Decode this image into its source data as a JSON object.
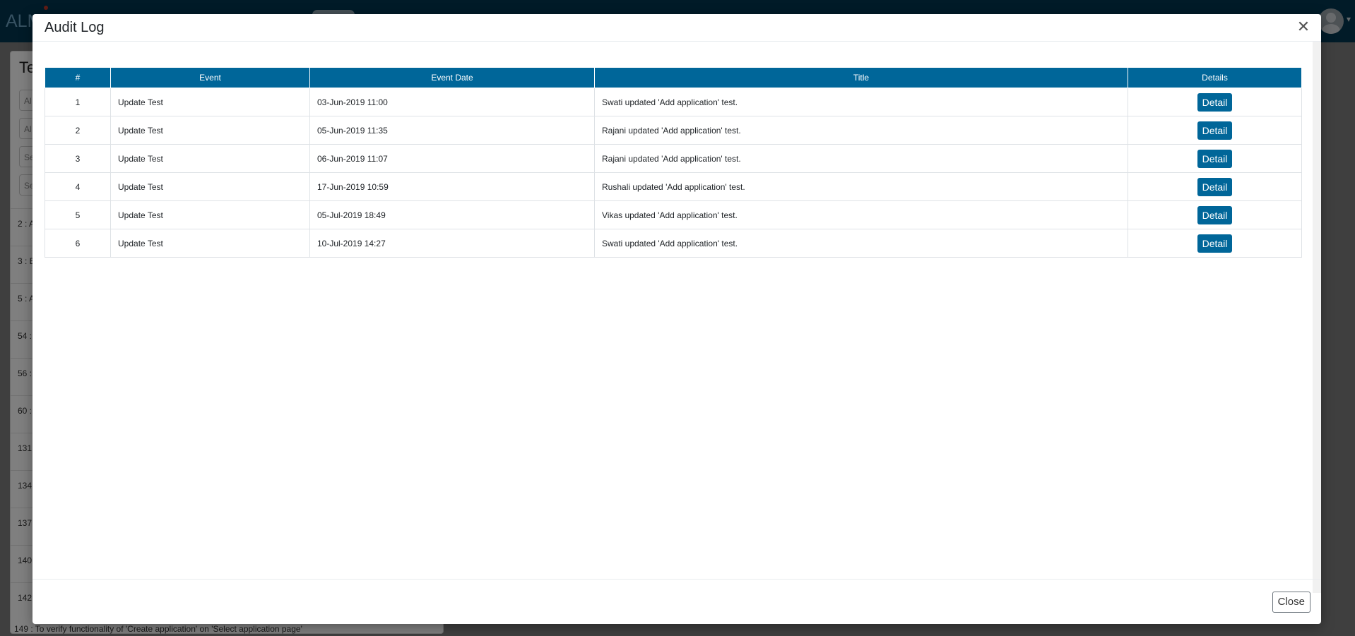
{
  "app": {
    "brand": "ALM"
  },
  "background": {
    "heading": "Te",
    "inputs": [
      "Al",
      "Al",
      "Se",
      "Se"
    ],
    "rows": [
      "2 : A",
      "3 : E",
      "5 : A",
      "54 :",
      "56 :",
      "60 :",
      "131",
      "134",
      "137",
      "140",
      "142"
    ],
    "bottom_text": "149 : To verify functionality of 'Create application' on 'Select application page'"
  },
  "modal": {
    "title": "Audit Log",
    "close_icon": "close-icon",
    "columns": [
      "#",
      "Event",
      "Event Date",
      "Title",
      "Details"
    ],
    "rows": [
      {
        "num": "1",
        "event": "Update Test",
        "date": "03-Jun-2019 11:00",
        "title": "Swati updated 'Add application' test.",
        "detail": "Detail"
      },
      {
        "num": "2",
        "event": "Update Test",
        "date": "05-Jun-2019 11:35",
        "title": "Rajani updated 'Add application' test.",
        "detail": "Detail"
      },
      {
        "num": "3",
        "event": "Update Test",
        "date": "06-Jun-2019 11:07",
        "title": "Rajani updated 'Add application' test.",
        "detail": "Detail"
      },
      {
        "num": "4",
        "event": "Update Test",
        "date": "17-Jun-2019 10:59",
        "title": "Rushali updated 'Add application' test.",
        "detail": "Detail"
      },
      {
        "num": "5",
        "event": "Update Test",
        "date": "05-Jul-2019 18:49",
        "title": "Vikas updated 'Add application' test.",
        "detail": "Detail"
      },
      {
        "num": "6",
        "event": "Update Test",
        "date": "10-Jul-2019 14:27",
        "title": "Swati updated 'Add application' test.",
        "detail": "Detail"
      }
    ],
    "footer": {
      "close_label": "Close"
    }
  },
  "colors": {
    "header_bg": "#006699",
    "navbar_bg": "#023750"
  }
}
